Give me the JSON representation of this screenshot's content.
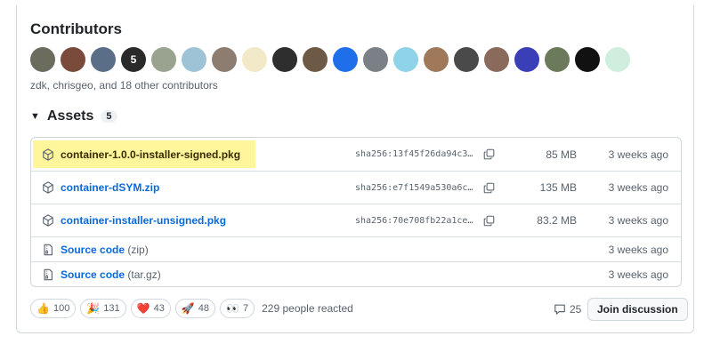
{
  "contributors": {
    "title": "Contributors",
    "summary": "zdk, chrisgeo, and 18 other contributors",
    "avatars": [
      {
        "icon": "avatar-photo-1",
        "label": "",
        "bg": "#6b6b5e"
      },
      {
        "icon": "avatar-photo-2",
        "label": "",
        "bg": "#7a4a3a"
      },
      {
        "icon": "avatar-photo-3",
        "label": "",
        "bg": "#5a6e88"
      },
      {
        "icon": "avatar-badge-5",
        "label": "5",
        "bg": "#2a2a2a"
      },
      {
        "icon": "avatar-photo-5",
        "label": "",
        "bg": "#9aa38f"
      },
      {
        "icon": "avatar-photo-6",
        "label": "",
        "bg": "#9ec3d6"
      },
      {
        "icon": "avatar-photo-7",
        "label": "",
        "bg": "#8c7d70"
      },
      {
        "icon": "avatar-drawing-8",
        "label": "",
        "bg": "#f1e9c8"
      },
      {
        "icon": "avatar-photo-9",
        "label": "",
        "bg": "#2e2e2e"
      },
      {
        "icon": "avatar-photo-10",
        "label": "",
        "bg": "#6d5a46"
      },
      {
        "icon": "avatar-robot-11",
        "label": "",
        "bg": "#1f6feb"
      },
      {
        "icon": "avatar-photo-12",
        "label": "",
        "bg": "#7b7f86"
      },
      {
        "icon": "avatar-logo-13",
        "label": "",
        "bg": "#8fd3e8"
      },
      {
        "icon": "avatar-photo-14",
        "label": "",
        "bg": "#a0785a"
      },
      {
        "icon": "avatar-photo-15",
        "label": "",
        "bg": "#4a4a4a"
      },
      {
        "icon": "avatar-photo-16",
        "label": "",
        "bg": "#8a6a5a"
      },
      {
        "icon": "avatar-photo-17",
        "label": "",
        "bg": "#3a3fb8"
      },
      {
        "icon": "avatar-photo-18",
        "label": "",
        "bg": "#6a7a5a"
      },
      {
        "icon": "avatar-photo-19",
        "label": "",
        "bg": "#111111"
      },
      {
        "icon": "avatar-identicon-20",
        "label": "",
        "bg": "#cfeedd"
      }
    ]
  },
  "assets": {
    "title": "Assets",
    "count": "5",
    "items": [
      {
        "name": "container-1.0.0-installer-signed.pkg",
        "sha": "sha256:13f45f26da94c3…",
        "size": "85 MB",
        "date": "3 weeks ago"
      },
      {
        "name": "container-dSYM.zip",
        "sha": "sha256:e7f1549a530a6c…",
        "size": "135 MB",
        "date": "3 weeks ago"
      },
      {
        "name": "container-installer-unsigned.pkg",
        "sha": "sha256:70e708fb22a1ce…",
        "size": "83.2 MB",
        "date": "3 weeks ago"
      }
    ],
    "source": [
      {
        "name": "Source code",
        "format": "(zip)",
        "date": "3 weeks ago"
      },
      {
        "name": "Source code",
        "format": "(tar.gz)",
        "date": "3 weeks ago"
      }
    ]
  },
  "reactions": {
    "items": [
      {
        "emoji": "👍",
        "icon": "thumbs-up-icon",
        "count": "100"
      },
      {
        "emoji": "🎉",
        "icon": "tada-icon",
        "count": "131"
      },
      {
        "emoji": "❤️",
        "icon": "heart-icon",
        "count": "43"
      },
      {
        "emoji": "🚀",
        "icon": "rocket-icon",
        "count": "48"
      },
      {
        "emoji": "👀",
        "icon": "eyes-icon",
        "count": "7"
      }
    ],
    "summary": "229 people reacted"
  },
  "discussion": {
    "comment_count": "25",
    "join_label": "Join discussion"
  },
  "colors": {
    "highlight": "#fff59a",
    "link": "#0969da"
  }
}
